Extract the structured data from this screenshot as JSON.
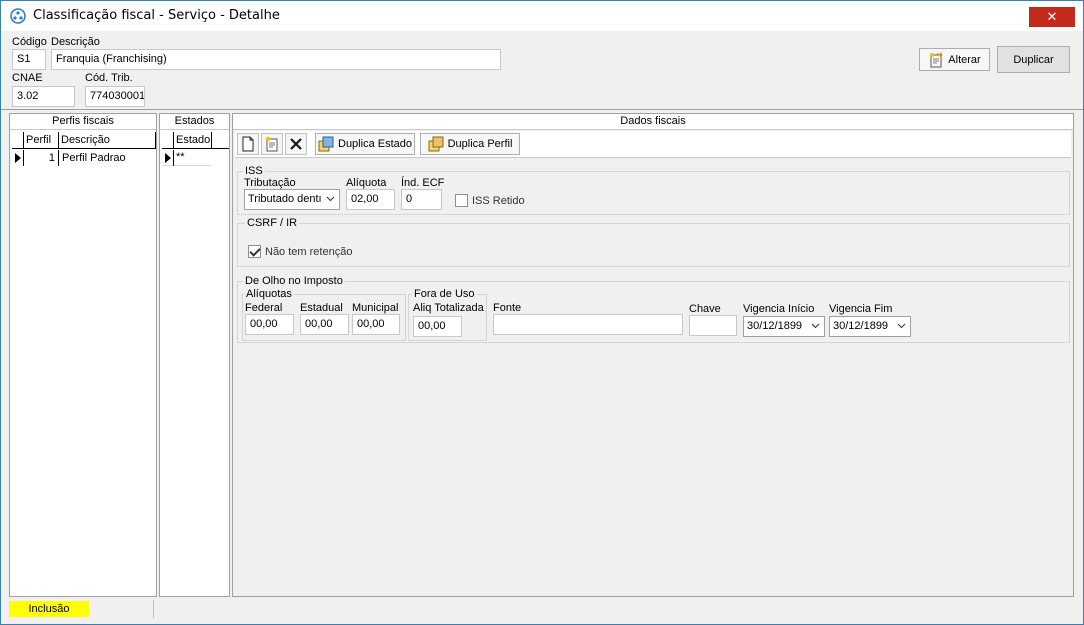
{
  "window": {
    "title": "Classificação fiscal - Serviço - Detalhe",
    "close_glyph": "✕"
  },
  "header": {
    "codigo_label": "Código",
    "codigo_value": "S1",
    "descricao_label": "Descrição",
    "descricao_value": "Franquia (Franchising)",
    "cnae_label": "CNAE",
    "cnae_value": "3.02",
    "cod_trib_label": "Cód. Trib.",
    "cod_trib_value": "774030001",
    "alterar_label": "Alterar",
    "duplicar_label": "Duplicar"
  },
  "perfis": {
    "title": "Perfis fiscais",
    "columns": [
      "Perfil",
      "Descrição"
    ],
    "rows": [
      {
        "perfil": "1",
        "descricao": "Perfil Padrao"
      }
    ]
  },
  "estados": {
    "title": "Estados",
    "column": "Estado",
    "rows": [
      {
        "estado": "**"
      }
    ]
  },
  "dados": {
    "title": "Dados fiscais",
    "duplica_estado_label": "Duplica Estado",
    "duplica_perfil_label": "Duplica Perfil",
    "iss": {
      "title": "ISS",
      "tributacao_label": "Tributação",
      "tributacao_value": "Tributado dentı",
      "aliquota_label": "Alíquota",
      "aliquota_value": "02,00",
      "ind_ecf_label": "Índ. ECF",
      "ind_ecf_value": "0",
      "iss_retido_label": "ISS Retido",
      "iss_retido_checked": false
    },
    "csrf": {
      "title": "CSRF / IR",
      "nao_tem_retencao_label": "Não tem retenção",
      "nao_tem_retencao_checked": true
    },
    "olho": {
      "title": "De Olho no Imposto",
      "aliquotas_title": "Alíquotas",
      "federal_label": "Federal",
      "federal_value": "00,00",
      "estadual_label": "Estadual",
      "estadual_value": "00,00",
      "municipal_label": "Municipal",
      "municipal_value": "00,00",
      "fora_title": "Fora de Uso",
      "aliq_totalizada_label": "Aliq Totalizada",
      "aliq_totalizada_value": "00,00",
      "fonte_label": "Fonte",
      "fonte_value": "",
      "chave_label": "Chave",
      "chave_value": "",
      "vig_inicio_label": "Vigencia Início",
      "vig_inicio_value": "30/12/1899",
      "vig_fim_label": "Vigencia Fim",
      "vig_fim_value": "30/12/1899"
    }
  },
  "status": {
    "mode": "Inclusão"
  }
}
